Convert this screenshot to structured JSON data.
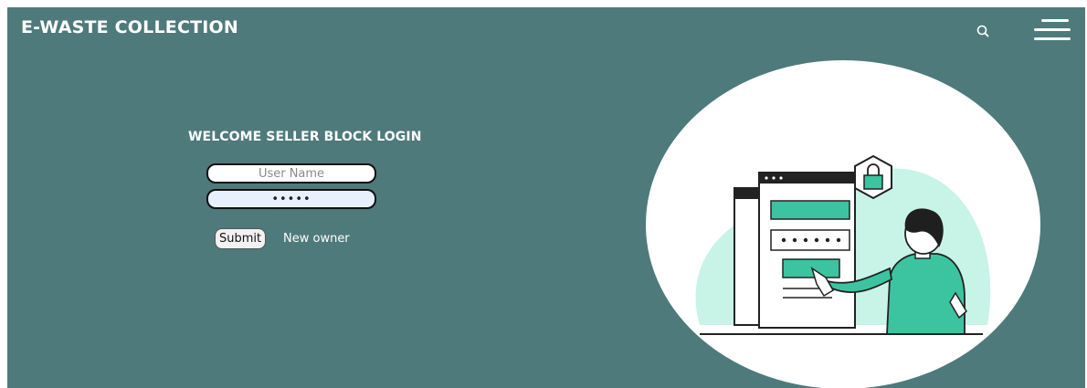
{
  "header": {
    "brand": "E-WASTE COLLECTION",
    "search_icon": "search-icon",
    "menu_icon": "hamburger-menu-icon"
  },
  "login": {
    "title": "WELCOME SELLER BLOCK LOGIN",
    "username_placeholder": "User Name",
    "password_value": "•••••",
    "submit_label": "Submit",
    "new_owner_link": "New owner"
  },
  "colors": {
    "background": "#4f7a7b",
    "accent": "#3cc4a0",
    "illustration_bg": "#ffffff"
  }
}
